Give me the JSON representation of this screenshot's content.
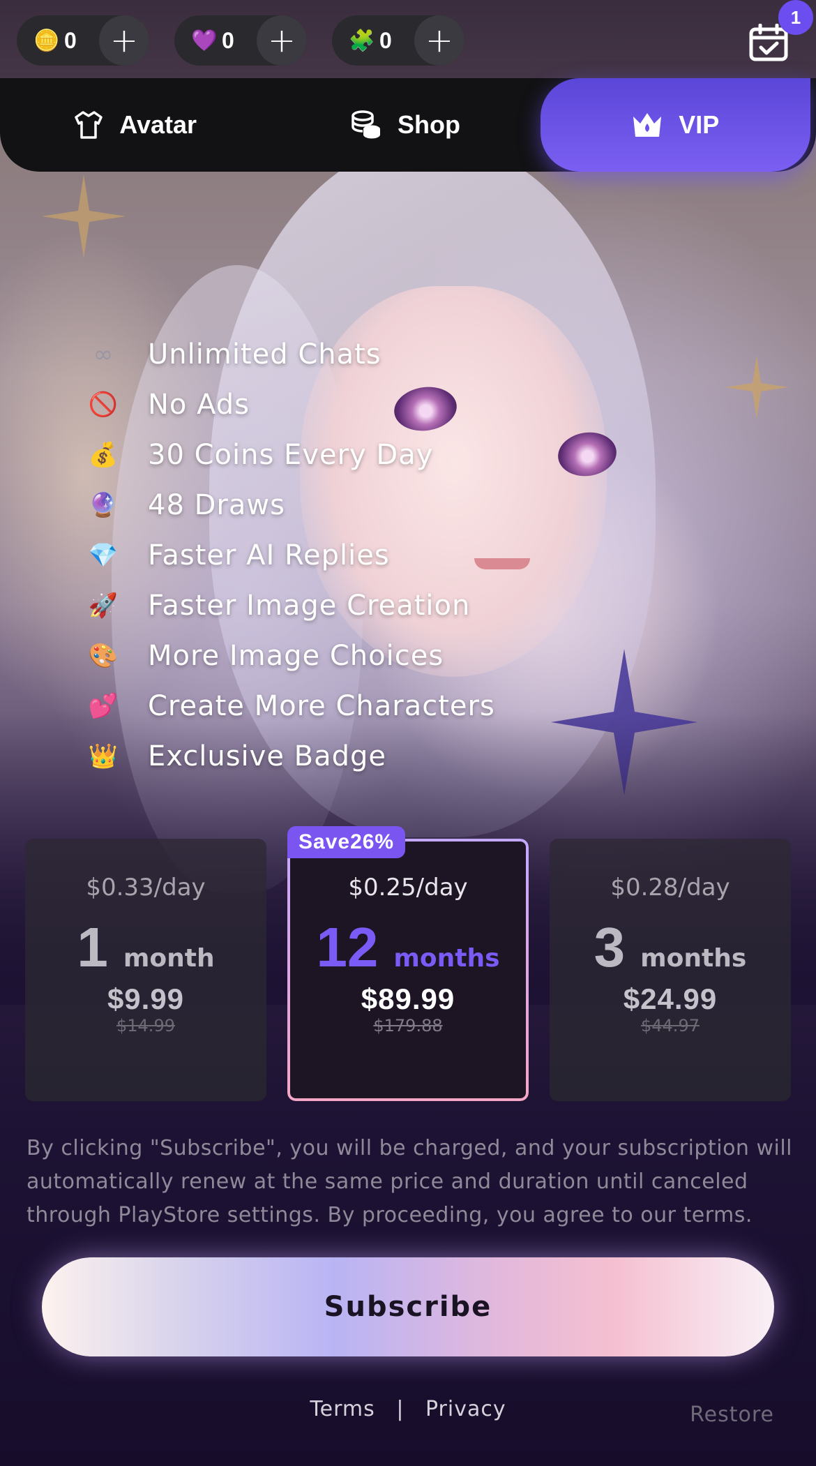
{
  "currencies": [
    {
      "icon": "coin-icon",
      "glyph": "🪙",
      "count": "0"
    },
    {
      "icon": "gem-icon",
      "glyph": "💜",
      "count": "0"
    },
    {
      "icon": "puzzle-icon",
      "glyph": "🧩",
      "count": "0"
    }
  ],
  "plus_label": "+",
  "notification_count": "1",
  "tabs": [
    {
      "label": "Avatar",
      "icon": "shirt-icon"
    },
    {
      "label": "Shop",
      "icon": "coins-stack-icon"
    },
    {
      "label": "VIP",
      "icon": "crown-icon",
      "active": true
    }
  ],
  "features": [
    {
      "glyph": "∞",
      "label": "Unlimited Chats"
    },
    {
      "glyph": "🚫",
      "label": "No Ads"
    },
    {
      "glyph": "💰",
      "label": "30 Coins Every Day"
    },
    {
      "glyph": "🔮",
      "label": "48 Draws"
    },
    {
      "glyph": "💎",
      "label": "Faster AI Replies"
    },
    {
      "glyph": "🚀",
      "label": "Faster Image Creation"
    },
    {
      "glyph": "🎨",
      "label": "More Image Choices"
    },
    {
      "glyph": "💕",
      "label": "Create More Characters"
    },
    {
      "glyph": "👑",
      "label": "Exclusive Badge"
    }
  ],
  "plans": [
    {
      "per_day": "$0.33/day",
      "num": "1",
      "unit": "month",
      "price": "$9.99",
      "original": "$14.99"
    },
    {
      "per_day": "$0.25/day",
      "num": "12",
      "unit": "months",
      "price": "$89.99",
      "original": "$179.88",
      "tag": "Save26%",
      "selected": true
    },
    {
      "per_day": "$0.28/day",
      "num": "3",
      "unit": "months",
      "price": "$24.99",
      "original": "$44.97"
    }
  ],
  "disclaimer": "By clicking \"Subscribe\", you will be charged, and your subscription will automatically renew at the same price and duration until canceled through PlayStore settings. By proceeding, you agree to our terms.",
  "subscribe_label": "Subscribe",
  "footer": {
    "terms": "Terms",
    "separator": "|",
    "privacy": "Privacy",
    "restore": "Restore"
  },
  "colors": {
    "accent": "#7a55f0",
    "badge": "#6b4df0",
    "background": "#1a0f2e"
  }
}
